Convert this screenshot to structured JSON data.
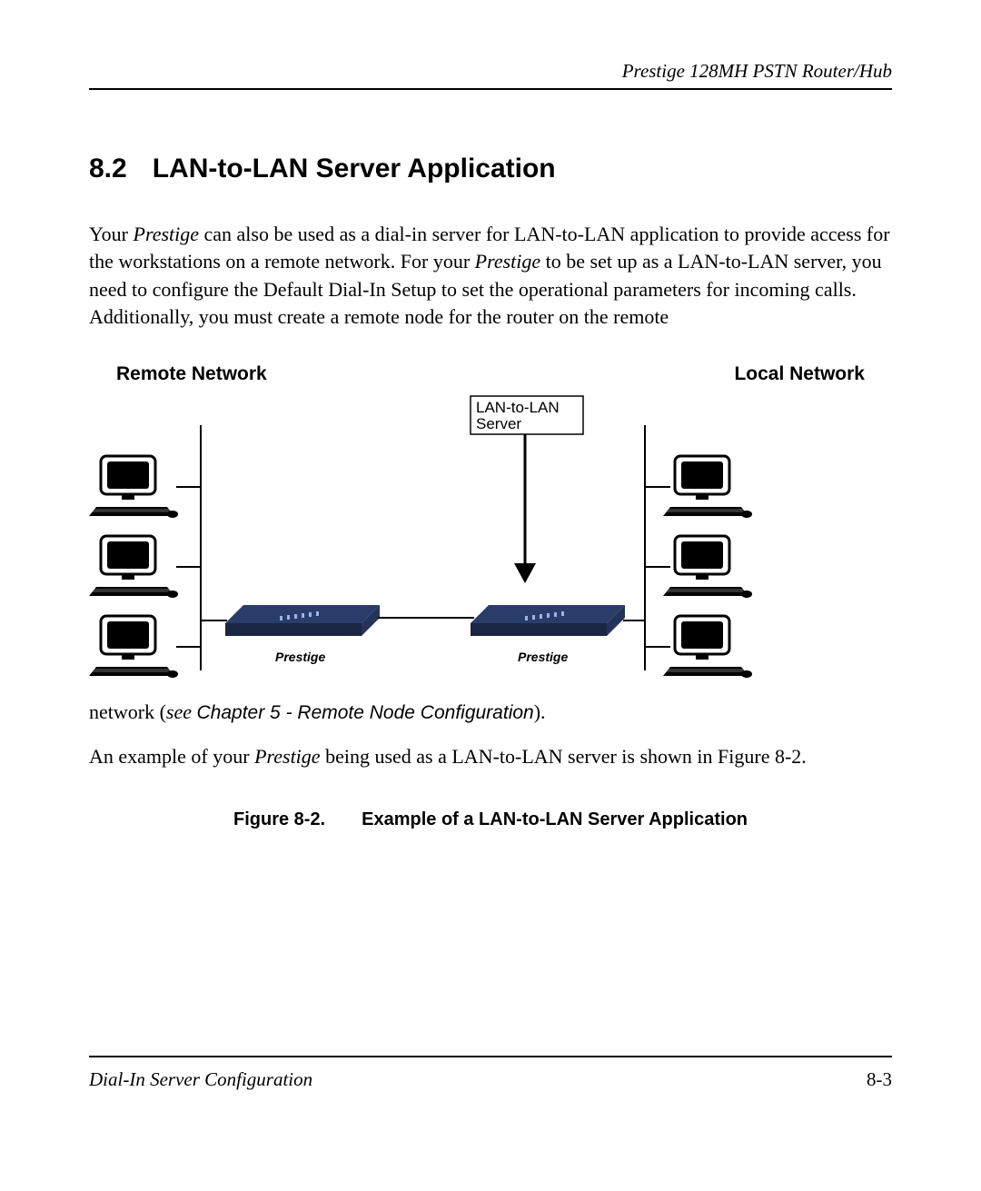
{
  "header": {
    "product": "Prestige 128MH  PSTN Router/Hub"
  },
  "section": {
    "number": "8.2",
    "title": "LAN-to-LAN Server Application"
  },
  "paragraph1": {
    "t1": "Your ",
    "prestige": "Prestige",
    "t2": " can also be used as a dial-in server for LAN-to-LAN application to provide access for the workstations on a remote network.  For your ",
    "t3": " to be set up as a LAN-to-LAN server, you need to configure the Default Dial-In Setup to set the operational parameters for incoming calls.  Additionally, you must create a remote node for the router on the remote"
  },
  "diagram": {
    "remote_label": "Remote Network",
    "local_label": "Local Network",
    "box_line1": "LAN-to-LAN",
    "box_line2": "Server",
    "router_left": "Prestige",
    "router_right": "Prestige"
  },
  "after_diagram": {
    "t1": "network (",
    "see": "see ",
    "ref": "Chapter 5 - Remote Node Configuration",
    "t2": ")."
  },
  "paragraph2": {
    "t1": "An example of your ",
    "prestige": "Prestige",
    "t2": " being used as a LAN-to-LAN server is shown in Figure 8-2."
  },
  "figure": {
    "num": "Figure 8-2.",
    "caption": "Example of a LAN-to-LAN Server Application"
  },
  "footer": {
    "left": "Dial-In Server Configuration",
    "right": "8-3"
  }
}
